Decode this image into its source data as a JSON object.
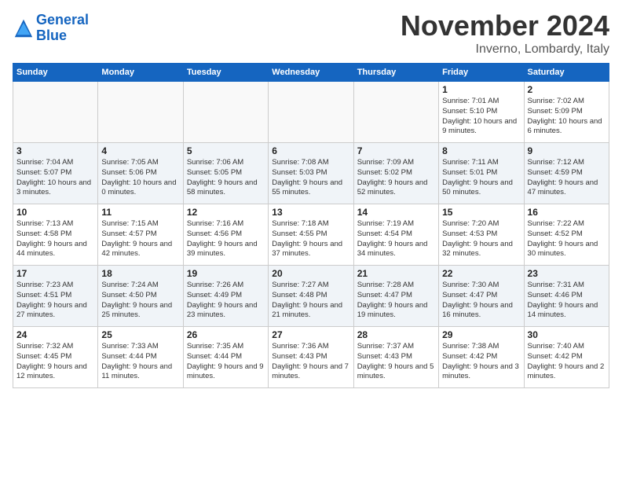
{
  "header": {
    "logo_line1": "General",
    "logo_line2": "Blue",
    "month": "November 2024",
    "location": "Inverno, Lombardy, Italy"
  },
  "days_of_week": [
    "Sunday",
    "Monday",
    "Tuesday",
    "Wednesday",
    "Thursday",
    "Friday",
    "Saturday"
  ],
  "weeks": [
    [
      {
        "day": "",
        "info": ""
      },
      {
        "day": "",
        "info": ""
      },
      {
        "day": "",
        "info": ""
      },
      {
        "day": "",
        "info": ""
      },
      {
        "day": "",
        "info": ""
      },
      {
        "day": "1",
        "info": "Sunrise: 7:01 AM\nSunset: 5:10 PM\nDaylight: 10 hours and 9 minutes."
      },
      {
        "day": "2",
        "info": "Sunrise: 7:02 AM\nSunset: 5:09 PM\nDaylight: 10 hours and 6 minutes."
      }
    ],
    [
      {
        "day": "3",
        "info": "Sunrise: 7:04 AM\nSunset: 5:07 PM\nDaylight: 10 hours and 3 minutes."
      },
      {
        "day": "4",
        "info": "Sunrise: 7:05 AM\nSunset: 5:06 PM\nDaylight: 10 hours and 0 minutes."
      },
      {
        "day": "5",
        "info": "Sunrise: 7:06 AM\nSunset: 5:05 PM\nDaylight: 9 hours and 58 minutes."
      },
      {
        "day": "6",
        "info": "Sunrise: 7:08 AM\nSunset: 5:03 PM\nDaylight: 9 hours and 55 minutes."
      },
      {
        "day": "7",
        "info": "Sunrise: 7:09 AM\nSunset: 5:02 PM\nDaylight: 9 hours and 52 minutes."
      },
      {
        "day": "8",
        "info": "Sunrise: 7:11 AM\nSunset: 5:01 PM\nDaylight: 9 hours and 50 minutes."
      },
      {
        "day": "9",
        "info": "Sunrise: 7:12 AM\nSunset: 4:59 PM\nDaylight: 9 hours and 47 minutes."
      }
    ],
    [
      {
        "day": "10",
        "info": "Sunrise: 7:13 AM\nSunset: 4:58 PM\nDaylight: 9 hours and 44 minutes."
      },
      {
        "day": "11",
        "info": "Sunrise: 7:15 AM\nSunset: 4:57 PM\nDaylight: 9 hours and 42 minutes."
      },
      {
        "day": "12",
        "info": "Sunrise: 7:16 AM\nSunset: 4:56 PM\nDaylight: 9 hours and 39 minutes."
      },
      {
        "day": "13",
        "info": "Sunrise: 7:18 AM\nSunset: 4:55 PM\nDaylight: 9 hours and 37 minutes."
      },
      {
        "day": "14",
        "info": "Sunrise: 7:19 AM\nSunset: 4:54 PM\nDaylight: 9 hours and 34 minutes."
      },
      {
        "day": "15",
        "info": "Sunrise: 7:20 AM\nSunset: 4:53 PM\nDaylight: 9 hours and 32 minutes."
      },
      {
        "day": "16",
        "info": "Sunrise: 7:22 AM\nSunset: 4:52 PM\nDaylight: 9 hours and 30 minutes."
      }
    ],
    [
      {
        "day": "17",
        "info": "Sunrise: 7:23 AM\nSunset: 4:51 PM\nDaylight: 9 hours and 27 minutes."
      },
      {
        "day": "18",
        "info": "Sunrise: 7:24 AM\nSunset: 4:50 PM\nDaylight: 9 hours and 25 minutes."
      },
      {
        "day": "19",
        "info": "Sunrise: 7:26 AM\nSunset: 4:49 PM\nDaylight: 9 hours and 23 minutes."
      },
      {
        "day": "20",
        "info": "Sunrise: 7:27 AM\nSunset: 4:48 PM\nDaylight: 9 hours and 21 minutes."
      },
      {
        "day": "21",
        "info": "Sunrise: 7:28 AM\nSunset: 4:47 PM\nDaylight: 9 hours and 19 minutes."
      },
      {
        "day": "22",
        "info": "Sunrise: 7:30 AM\nSunset: 4:47 PM\nDaylight: 9 hours and 16 minutes."
      },
      {
        "day": "23",
        "info": "Sunrise: 7:31 AM\nSunset: 4:46 PM\nDaylight: 9 hours and 14 minutes."
      }
    ],
    [
      {
        "day": "24",
        "info": "Sunrise: 7:32 AM\nSunset: 4:45 PM\nDaylight: 9 hours and 12 minutes."
      },
      {
        "day": "25",
        "info": "Sunrise: 7:33 AM\nSunset: 4:44 PM\nDaylight: 9 hours and 11 minutes."
      },
      {
        "day": "26",
        "info": "Sunrise: 7:35 AM\nSunset: 4:44 PM\nDaylight: 9 hours and 9 minutes."
      },
      {
        "day": "27",
        "info": "Sunrise: 7:36 AM\nSunset: 4:43 PM\nDaylight: 9 hours and 7 minutes."
      },
      {
        "day": "28",
        "info": "Sunrise: 7:37 AM\nSunset: 4:43 PM\nDaylight: 9 hours and 5 minutes."
      },
      {
        "day": "29",
        "info": "Sunrise: 7:38 AM\nSunset: 4:42 PM\nDaylight: 9 hours and 3 minutes."
      },
      {
        "day": "30",
        "info": "Sunrise: 7:40 AM\nSunset: 4:42 PM\nDaylight: 9 hours and 2 minutes."
      }
    ]
  ]
}
